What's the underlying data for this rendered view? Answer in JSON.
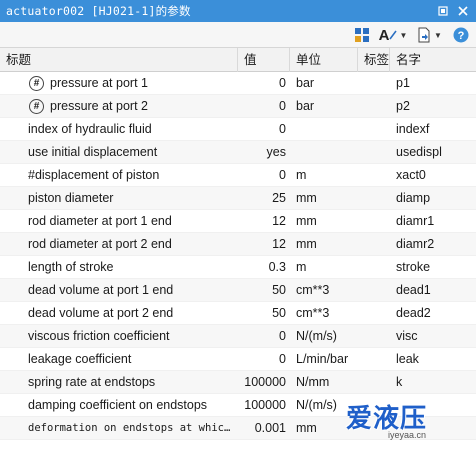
{
  "window": {
    "title": "actuator002 [HJ021-1]的参数",
    "pin_icon": "pin-icon",
    "close_icon": "close-icon"
  },
  "toolbar": {
    "tools": [
      {
        "name": "parameter-view-icon"
      },
      {
        "name": "font-style-icon"
      },
      {
        "name": "export-settings-icon"
      },
      {
        "name": "help-icon"
      }
    ]
  },
  "table": {
    "columns": {
      "label": "标题",
      "value": "值",
      "unit": "单位",
      "tag": "标签",
      "name": "名字"
    },
    "rows": [
      {
        "label": "pressure at port 1",
        "value": "0",
        "unit": "bar",
        "name": "p1",
        "has_icon": true
      },
      {
        "label": "pressure at port 2",
        "value": "0",
        "unit": "bar",
        "name": "p2",
        "has_icon": true
      },
      {
        "label": "index of hydraulic fluid",
        "value": "0",
        "unit": "",
        "name": "indexf"
      },
      {
        "label": "use initial displacement",
        "value": "yes",
        "unit": "",
        "name": "usedispl"
      },
      {
        "label": "#displacement of piston",
        "value": "0",
        "unit": "m",
        "name": "xact0"
      },
      {
        "label": "piston diameter",
        "value": "25",
        "unit": "mm",
        "name": "diamp"
      },
      {
        "label": "rod diameter at port 1 end",
        "value": "12",
        "unit": "mm",
        "name": "diamr1"
      },
      {
        "label": "rod diameter at port 2 end",
        "value": "12",
        "unit": "mm",
        "name": "diamr2"
      },
      {
        "label": "length of stroke",
        "value": "0.3",
        "unit": "m",
        "name": "stroke"
      },
      {
        "label": "dead volume at port 1 end",
        "value": "50",
        "unit": "cm**3",
        "name": "dead1"
      },
      {
        "label": "dead volume at port 2 end",
        "value": "50",
        "unit": "cm**3",
        "name": "dead2"
      },
      {
        "label": "viscous friction coefficient",
        "value": "0",
        "unit": "N/(m/s)",
        "name": "visc"
      },
      {
        "label": "leakage coefficient",
        "value": "0",
        "unit": "L/min/bar",
        "name": "leak"
      },
      {
        "label": "spring rate at endstops",
        "value": "100000",
        "unit": "N/mm",
        "name": "k"
      },
      {
        "label": "damping coefficient on endstops",
        "value": "100000",
        "unit": "N/(m/s)",
        "name": ""
      },
      {
        "label": "deformation on endstops at whic…",
        "value": "0.001",
        "unit": "mm",
        "name": ""
      }
    ]
  },
  "watermark": {
    "text": "爱液压",
    "sub": "iyeyaa.cn"
  }
}
